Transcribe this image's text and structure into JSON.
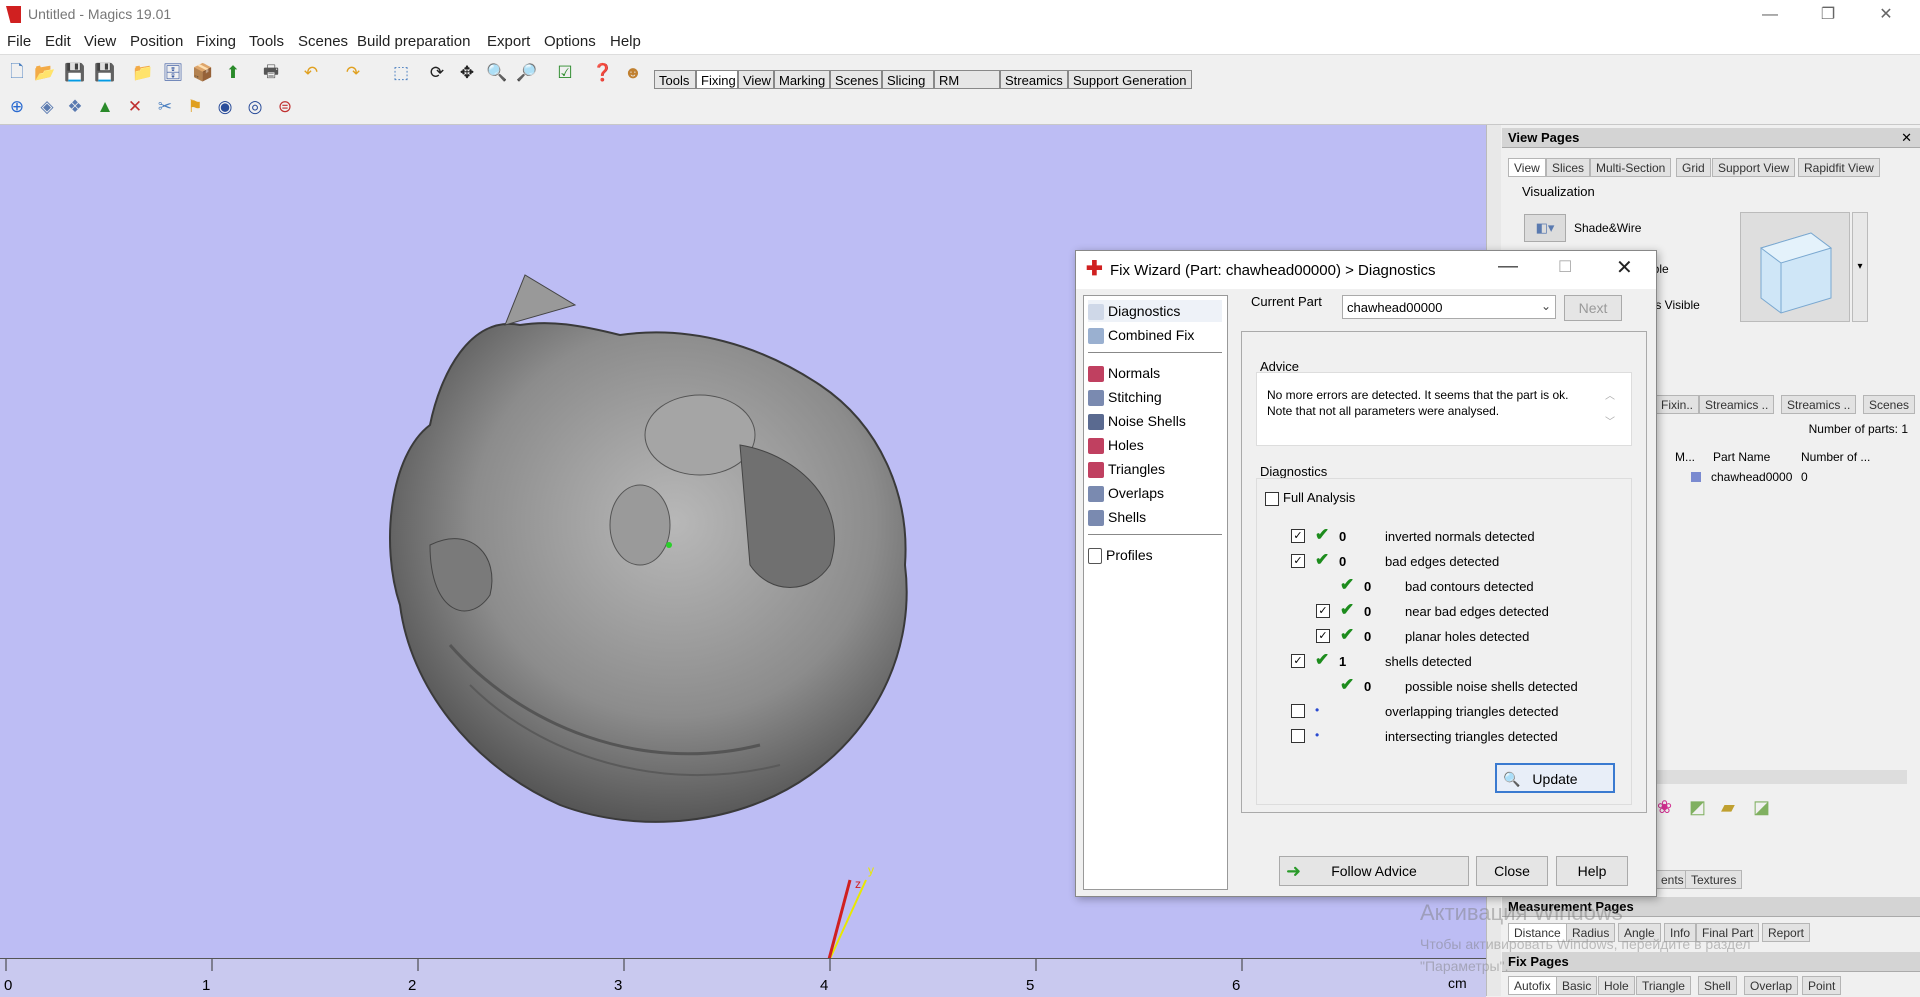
{
  "window": {
    "title": "Untitled - Magics 19.01",
    "controls": [
      "—",
      "❐",
      "✕"
    ]
  },
  "menu": [
    "File",
    "Edit",
    "View",
    "Position",
    "Fixing",
    "Tools",
    "Scenes",
    "Build preparation",
    "Export",
    "Options",
    "Help"
  ],
  "toolbar_tabs": [
    "Tools",
    "Fixing",
    "View",
    "Marking",
    "Scenes",
    "Slicing",
    "RM Slicer",
    "Streamics",
    "Support Generation"
  ],
  "active_toolbar_tab": "Fixing",
  "ruler": {
    "labels": [
      "0",
      "1",
      "2",
      "3",
      "4",
      "5",
      "6"
    ],
    "unit": "cm"
  },
  "axes": {
    "y": "y",
    "z": "z"
  },
  "view_pages": {
    "title": "View Pages",
    "tabs": [
      "View",
      "Slices",
      "Multi-Section",
      "Grid",
      "Support View",
      "Rapidfit View"
    ],
    "active_tab": "View",
    "group": "Visualization",
    "shade_wire": "Shade&Wire",
    "visible_partial": "ible",
    "triangles_visible_partial": "les Visible"
  },
  "part_panel": {
    "tabs": [
      "Fixin..",
      "Streamics ..",
      "Streamics ..",
      "Scenes"
    ],
    "number_of_parts": "Number of parts: 1",
    "columns": [
      "M...",
      "Part Name",
      "Number of ..."
    ],
    "row": {
      "name": "chawhead0000",
      "number": "0"
    }
  },
  "bottom_panel": {
    "tabs": [
      "ents",
      "Textures"
    ]
  },
  "measurement_pages": {
    "title": "Measurement Pages",
    "tabs": [
      "Distance",
      "Radius",
      "Angle",
      "Info",
      "Final Part",
      "Report"
    ],
    "active_tab": "Distance"
  },
  "fix_pages": {
    "title": "Fix Pages",
    "tabs": [
      "Autofix",
      "Basic",
      "Hole",
      "Triangle",
      "Shell",
      "Overlap",
      "Point"
    ],
    "active_tab": "Autofix"
  },
  "watermark": {
    "line1": "Активация Windows",
    "line2": "Чтобы активировать Windows, перейдите в раздел",
    "line3": "\"Параметры\"."
  },
  "dialog": {
    "title": "Fix Wizard (Part: chawhead00000) > Diagnostics",
    "nav_top": [
      "Diagnostics",
      "Combined Fix"
    ],
    "nav_mid": [
      "Normals",
      "Stitching",
      "Noise Shells",
      "Holes",
      "Triangles",
      "Overlaps",
      "Shells"
    ],
    "nav_bottom": [
      "Profiles"
    ],
    "current_part_label": "Current Part",
    "current_part_value": "chawhead00000",
    "next_button": "Next",
    "advice_label": "Advice",
    "advice_text": "No more errors are detected. It seems that the part is ok. Note that not all parameters were analysed.",
    "diagnostics_label": "Diagnostics",
    "full_analysis_label": "Full Analysis",
    "items": [
      {
        "checkbox": true,
        "checked": true,
        "ok": true,
        "value": "0",
        "label": "inverted normals detected",
        "indent": 0
      },
      {
        "checkbox": true,
        "checked": true,
        "ok": true,
        "value": "0",
        "label": "bad edges detected",
        "indent": 0
      },
      {
        "checkbox": false,
        "checked": false,
        "ok": true,
        "value": "0",
        "label": "bad contours detected",
        "indent": 1
      },
      {
        "checkbox": true,
        "checked": true,
        "ok": true,
        "value": "0",
        "label": "near bad edges detected",
        "indent": 1
      },
      {
        "checkbox": true,
        "checked": true,
        "ok": true,
        "value": "0",
        "label": "planar holes detected",
        "indent": 1
      },
      {
        "checkbox": true,
        "checked": true,
        "ok": true,
        "value": "1",
        "label": "shells detected",
        "indent": 0
      },
      {
        "checkbox": false,
        "checked": false,
        "ok": true,
        "value": "0",
        "label": "possible noise shells detected",
        "indent": 1
      },
      {
        "checkbox": true,
        "checked": false,
        "ok": false,
        "value": "",
        "label": "overlapping triangles detected",
        "indent": 0
      },
      {
        "checkbox": true,
        "checked": false,
        "ok": false,
        "value": "",
        "label": "intersecting triangles detected",
        "indent": 0
      }
    ],
    "update_button": "Update",
    "follow_advice_button": "Follow Advice",
    "close_button": "Close",
    "help_button": "Help"
  },
  "colors": {
    "viewport": "#bdbdf4",
    "ok_green": "#1d8c1d",
    "fix_red": "#d02020"
  }
}
